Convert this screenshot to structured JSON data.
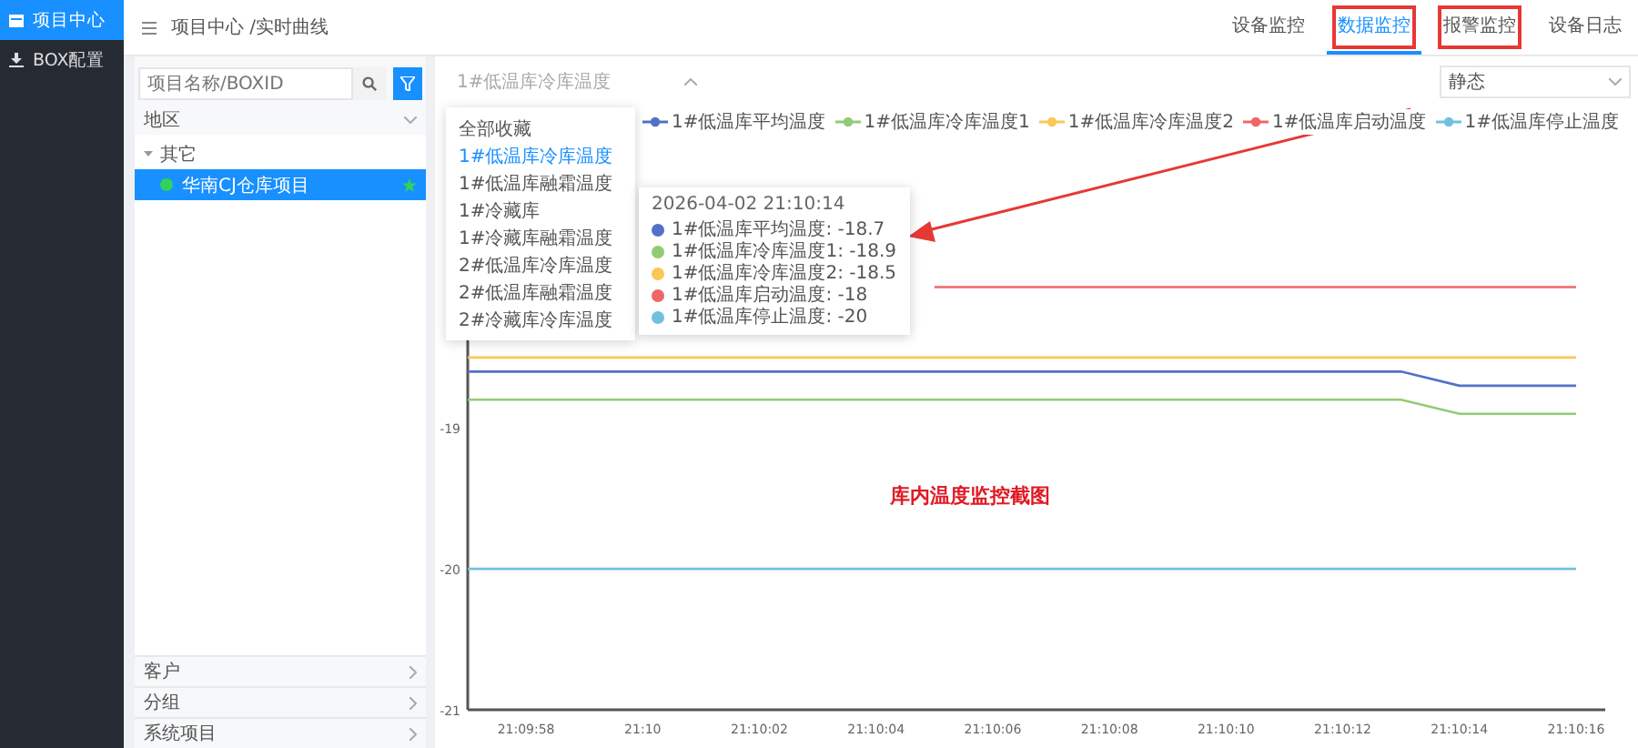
{
  "sidebar": {
    "items": [
      {
        "label": "项目中心",
        "selected": true
      },
      {
        "label": "BOX配置",
        "selected": false
      }
    ]
  },
  "header": {
    "breadcrumb": "项目中心 /实时曲线",
    "tabs": [
      {
        "label": "设备监控",
        "selected": false,
        "highlighted": false
      },
      {
        "label": "数据监控",
        "selected": true,
        "highlighted": true
      },
      {
        "label": "报警监控",
        "selected": false,
        "highlighted": true
      },
      {
        "label": "设备日志",
        "selected": false,
        "highlighted": false
      }
    ]
  },
  "project_panel": {
    "search": {
      "placeholder": "项目名称/BOXID"
    },
    "region": "地区",
    "tree": [
      {
        "label": "其它",
        "expanded": true,
        "children": [
          {
            "label": "华南CJ仓库项目",
            "selected": true,
            "color": "#2fd35c",
            "starred": true
          }
        ]
      }
    ],
    "sections": [
      "客户",
      "分组",
      "系统项目"
    ]
  },
  "chart_panel": {
    "sensor_select": {
      "value": "1#低温库冷库温度"
    },
    "mode_select": {
      "value": "静态"
    },
    "sensor_menu": {
      "items": [
        {
          "label": "全部收藏",
          "selected": false
        },
        {
          "label": "1#低温库冷库温度",
          "selected": true
        },
        {
          "label": "1#低温库融霜温度",
          "selected": false
        },
        {
          "label": "1#冷藏库",
          "selected": false
        },
        {
          "label": "1#冷藏库融霜温度",
          "selected": false
        },
        {
          "label": "2#低温库冷库温度",
          "selected": false
        },
        {
          "label": "2#低温库融霜温度",
          "selected": false
        },
        {
          "label": "2#冷藏库冷库温度",
          "selected": false
        }
      ]
    },
    "tooltip": {
      "time": "2026-04-02 21:10:14",
      "entries": [
        {
          "label": "1#低温库平均温度: -18.7",
          "color": "#5470c6"
        },
        {
          "label": "1#低温库冷库温度1: -18.9",
          "color": "#91cc75"
        },
        {
          "label": "1#低温库冷库温度2: -18.5",
          "color": "#fac858"
        },
        {
          "label": "1#低温库启动温度: -18",
          "color": "#ee6666"
        },
        {
          "label": "1#低温库停止温度: -20",
          "color": "#73c0de"
        }
      ]
    },
    "note": "库内温度监控截图",
    "chart_data": {
      "type": "line",
      "categories": [
        null,
        "21:09:58",
        null,
        "21:10",
        null,
        "21:10:02",
        null,
        "21:10:04",
        null,
        "21:10:06",
        null,
        "21:10:08",
        null,
        "21:10:10",
        null,
        "21:10:12",
        null,
        "21:10:14",
        null,
        "21:10:16"
      ],
      "ylim": [
        -21,
        -17.5
      ],
      "yticks": [
        -21,
        -20,
        -19
      ],
      "series": [
        {
          "name": "1#低温库平均温度",
          "color": "#5470c6",
          "values": [
            -18.6,
            -18.6,
            -18.6,
            -18.6,
            -18.6,
            -18.6,
            -18.6,
            -18.6,
            -18.6,
            -18.6,
            -18.6,
            -18.6,
            -18.6,
            -18.6,
            -18.6,
            -18.6,
            -18.6,
            -18.7,
            -18.7,
            -18.7
          ]
        },
        {
          "name": "1#低温库冷库温度1",
          "color": "#91cc75",
          "values": [
            -18.8,
            -18.8,
            -18.8,
            -18.8,
            -18.8,
            -18.8,
            -18.8,
            -18.8,
            -18.8,
            -18.8,
            -18.8,
            -18.8,
            -18.8,
            -18.8,
            -18.8,
            -18.8,
            -18.8,
            -18.9,
            -18.9,
            -18.9
          ]
        },
        {
          "name": "1#低温库冷库温度2",
          "color": "#fac858",
          "values": [
            -18.5,
            -18.5,
            -18.5,
            -18.5,
            -18.5,
            -18.5,
            -18.5,
            -18.5,
            -18.5,
            -18.5,
            -18.5,
            -18.5,
            -18.5,
            -18.5,
            -18.5,
            -18.5,
            -18.5,
            -18.5,
            -18.5,
            -18.5
          ]
        },
        {
          "name": "1#低温库启动温度",
          "color": "#ee6666",
          "values": [
            null,
            null,
            null,
            null,
            null,
            null,
            null,
            null,
            -18,
            -18,
            -18,
            -18,
            -18,
            -18,
            -18,
            -18,
            -18,
            -18,
            -18,
            -18
          ]
        },
        {
          "name": "1#低温库停止温度",
          "color": "#73c0de",
          "values": [
            -20,
            -20,
            -20,
            -20,
            -20,
            -20,
            -20,
            -20,
            -20,
            -20,
            -20,
            -20,
            -20,
            -20,
            -20,
            -20,
            -20,
            -20,
            -20,
            -20
          ]
        }
      ]
    }
  }
}
